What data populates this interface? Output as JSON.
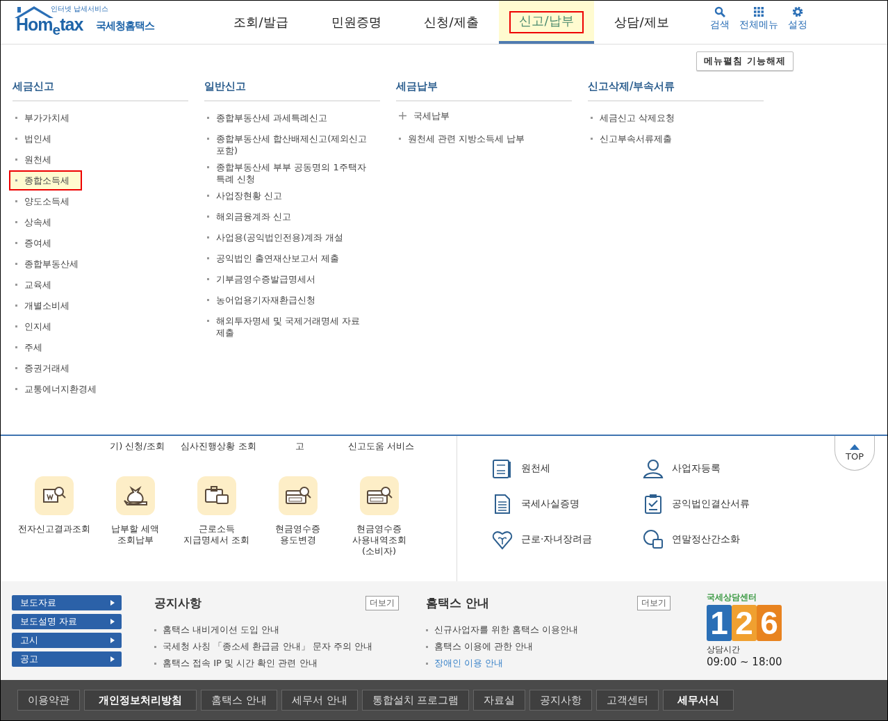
{
  "header": {
    "logo": {
      "tagline": "인터넷 납세서비스",
      "wordmark": "Hom$_{e}$tax",
      "name": "국세청홈택스"
    },
    "nav": [
      {
        "label": "조회/발급",
        "selected": false,
        "highlighted": false
      },
      {
        "label": "민원증명",
        "selected": false,
        "highlighted": false
      },
      {
        "label": "신청/제출",
        "selected": false,
        "highlighted": false
      },
      {
        "label": "신고/납부",
        "selected": true,
        "highlighted": true
      },
      {
        "label": "상담/제보",
        "selected": false,
        "highlighted": false
      }
    ],
    "tools": [
      {
        "kind": "search",
        "label": "검색"
      },
      {
        "kind": "grid",
        "label": "전체메뉴"
      },
      {
        "kind": "gear",
        "label": "설정"
      }
    ]
  },
  "mega_menu": {
    "toggle_button": "메뉴펼침 기능해제",
    "columns": [
      {
        "title": "세금신고",
        "items": [
          {
            "label": "부가가치세",
            "kind": "bullet",
            "highlighted": false
          },
          {
            "label": "법인세",
            "kind": "bullet",
            "highlighted": false
          },
          {
            "label": "원천세",
            "kind": "bullet",
            "highlighted": false
          },
          {
            "label": "종합소득세",
            "kind": "bullet",
            "highlighted": true
          },
          {
            "label": "양도소득세",
            "kind": "bullet",
            "highlighted": false
          },
          {
            "label": "상속세",
            "kind": "bullet",
            "highlighted": false
          },
          {
            "label": "증여세",
            "kind": "bullet",
            "highlighted": false
          },
          {
            "label": "종합부동산세",
            "kind": "bullet",
            "highlighted": false
          },
          {
            "label": "교육세",
            "kind": "bullet",
            "highlighted": false
          },
          {
            "label": "개별소비세",
            "kind": "bullet",
            "highlighted": false
          },
          {
            "label": "인지세",
            "kind": "bullet",
            "highlighted": false
          },
          {
            "label": "주세",
            "kind": "bullet",
            "highlighted": false
          },
          {
            "label": "증권거래세",
            "kind": "bullet",
            "highlighted": false
          },
          {
            "label": "교통에너지환경세",
            "kind": "bullet",
            "highlighted": false
          }
        ]
      },
      {
        "title": "일반신고",
        "items": [
          {
            "label": "종합부동산세 과세특례신고",
            "kind": "bullet",
            "highlighted": false
          },
          {
            "label": "종합부동산세 합산배제신고(제외신고 포함)",
            "kind": "bullet",
            "highlighted": false
          },
          {
            "label": "종합부동산세 부부 공동명의 1주택자 특례 신청",
            "kind": "bullet",
            "highlighted": false
          },
          {
            "label": "사업장현황 신고",
            "kind": "bullet",
            "highlighted": false
          },
          {
            "label": "해외금융계좌 신고",
            "kind": "bullet",
            "highlighted": false
          },
          {
            "label": "사업용(공익법인전용)계좌 개설",
            "kind": "bullet",
            "highlighted": false
          },
          {
            "label": "공익법인 출연재산보고서 제출",
            "kind": "bullet",
            "highlighted": false
          },
          {
            "label": "기부금영수증발급명세서",
            "kind": "bullet",
            "highlighted": false
          },
          {
            "label": "농어업용기자재환급신청",
            "kind": "bullet",
            "highlighted": false
          },
          {
            "label": "해외투자명세 및 국제거래명세 자료 제출",
            "kind": "bullet",
            "highlighted": false
          }
        ]
      },
      {
        "title": "세금납부",
        "items": [
          {
            "label": "국세납부",
            "kind": "plus",
            "highlighted": false
          },
          {
            "label": "원천세 관련 지방소득세 납부",
            "kind": "bullet",
            "highlighted": false
          }
        ]
      },
      {
        "title": "신고삭제/부속서류",
        "items": [
          {
            "label": "세금신고 삭제요청",
            "kind": "bullet",
            "highlighted": false
          },
          {
            "label": "신고부속서류제출",
            "kind": "bullet",
            "highlighted": false
          }
        ]
      }
    ]
  },
  "quick_services": {
    "cut_labels": [
      "기) 신청/조회",
      "심사진행상황 조회",
      "고",
      "신고도움 서비스"
    ],
    "items": [
      {
        "kind": "report",
        "label": "전자신고결과조회"
      },
      {
        "kind": "moneybag",
        "label": "납부할 세액 조회납부"
      },
      {
        "kind": "wallet",
        "label": "근로소득 지급명세서 조회"
      },
      {
        "kind": "card",
        "label": "현금영수증 용도변경"
      },
      {
        "kind": "card",
        "label": "현금영수증 사용내역조회 (소비자)"
      }
    ]
  },
  "shortcuts": [
    {
      "kind": "salary",
      "label": "원천세"
    },
    {
      "kind": "person",
      "label": "사업자등록"
    },
    {
      "kind": "document",
      "label": "국세사실증명"
    },
    {
      "kind": "clipboard",
      "label": "공익법인결산서류"
    },
    {
      "kind": "heart",
      "label": "근로·자녀장려금"
    },
    {
      "kind": "chat",
      "label": "연말정산간소화"
    }
  ],
  "top_button": "TOP",
  "side_links": [
    "보도자료",
    "보도설명 자료",
    "고시",
    "공고"
  ],
  "boards": [
    {
      "title": "공지사항",
      "more": "더보기",
      "items": [
        {
          "text": "홈택스 내비게이션 도입 안내",
          "link": false
        },
        {
          "text": "국세청 사칭 「종소세 환급금 안내」 문자 주의 안내",
          "link": false
        },
        {
          "text": "홈택스 접속 IP 및 시간 확인 관련 안내",
          "link": false
        }
      ]
    },
    {
      "title": "홈택스 안내",
      "more": "더보기",
      "items": [
        {
          "text": "신규사업자를 위한 홈택스 이용안내",
          "link": false
        },
        {
          "text": "홈택스 이용에 관한 안내",
          "link": false
        },
        {
          "text": "장애인 이용 안내",
          "link": true
        }
      ]
    }
  ],
  "call_center": {
    "title": "국세상담센터",
    "number": "126",
    "hours_label": "상담시간",
    "hours": "09:00 ~ 18:00"
  },
  "footer_links": [
    {
      "label": "이용약관",
      "bold": false
    },
    {
      "label": "개인정보처리방침",
      "bold": true
    },
    {
      "label": "홈택스 안내",
      "bold": false
    },
    {
      "label": "세무서 안내",
      "bold": false
    },
    {
      "label": "통합설치 프로그램",
      "bold": false
    },
    {
      "label": "자료실",
      "bold": false
    },
    {
      "label": "공지사항",
      "bold": false
    },
    {
      "label": "고객센터",
      "bold": false
    },
    {
      "label": "세무서식",
      "bold": true
    }
  ]
}
